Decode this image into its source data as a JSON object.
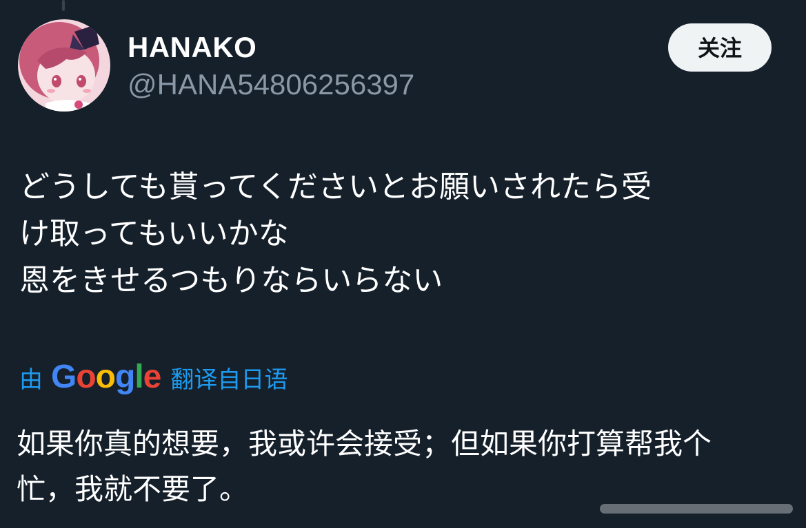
{
  "user": {
    "display_name": "HANAKO",
    "handle": "@HANA54806256397",
    "avatar_icon": "anime-girl-avatar"
  },
  "follow_button": {
    "label": "关注"
  },
  "tweet": {
    "text": "どうしても貰ってくださいとお願いされたら受\nけ取ってもいいかな\n恩をきせるつもりならいらない"
  },
  "translation": {
    "prefix": "由",
    "provider_logo": "Google",
    "suffix": "翻译自日语",
    "text": "如果你真的想要，我或许会接受；但如果你打算帮我个\n忙，我就不要了。"
  },
  "colors": {
    "background": "#15202b",
    "link": "#1d9bf0",
    "secondary_text": "#8b98a5",
    "button_bg": "#eff3f4"
  }
}
